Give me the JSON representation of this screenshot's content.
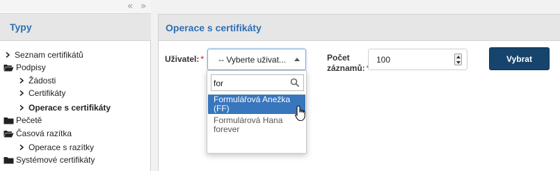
{
  "left_panel": {
    "collapse_left_symbol": "«",
    "collapse_right_symbol": "»",
    "title": "Typy",
    "tree": [
      {
        "label": "Seznam certifikátů",
        "icon": "chevron-right-icon",
        "level": 0,
        "active": false
      },
      {
        "label": "Podpisy",
        "icon": "folder-open-icon",
        "level": 0,
        "active": false
      },
      {
        "label": "Žádosti",
        "icon": "chevron-right-icon",
        "level": 1,
        "active": false
      },
      {
        "label": "Certifikáty",
        "icon": "chevron-right-icon",
        "level": 1,
        "active": false
      },
      {
        "label": "Operace s certifikáty",
        "icon": "chevron-right-icon",
        "level": 1,
        "active": true
      },
      {
        "label": "Pečetě",
        "icon": "folder-closed-icon",
        "level": 0,
        "active": false
      },
      {
        "label": "Časová razítka",
        "icon": "folder-open-icon",
        "level": 0,
        "active": false
      },
      {
        "label": "Operace s razítky",
        "icon": "chevron-right-icon",
        "level": 1,
        "active": false
      },
      {
        "label": "Systémové certifikáty",
        "icon": "folder-closed-icon",
        "level": 0,
        "active": false
      }
    ]
  },
  "main": {
    "title": "Operace s certifikáty",
    "user_field": {
      "label": "Uživatel:",
      "required_mark": "*",
      "selected_text": "-- Vyberte uživat...",
      "search_value": "for",
      "options": [
        {
          "line1": "Formulářová Anežka",
          "line2": "(FF)",
          "highlighted": true
        },
        {
          "line1": "Formulárová Hana",
          "line2": "forever",
          "highlighted": false
        }
      ]
    },
    "count_field": {
      "label_line1": "Počet",
      "label_line2": "záznamů:",
      "required_mark": "*",
      "value": "100"
    },
    "submit_label": "Vybrat"
  },
  "colors": {
    "accent_title": "#2f6eb4",
    "button_bg": "#17446c",
    "highlight_bg": "#3876be",
    "required": "#d9534f"
  }
}
